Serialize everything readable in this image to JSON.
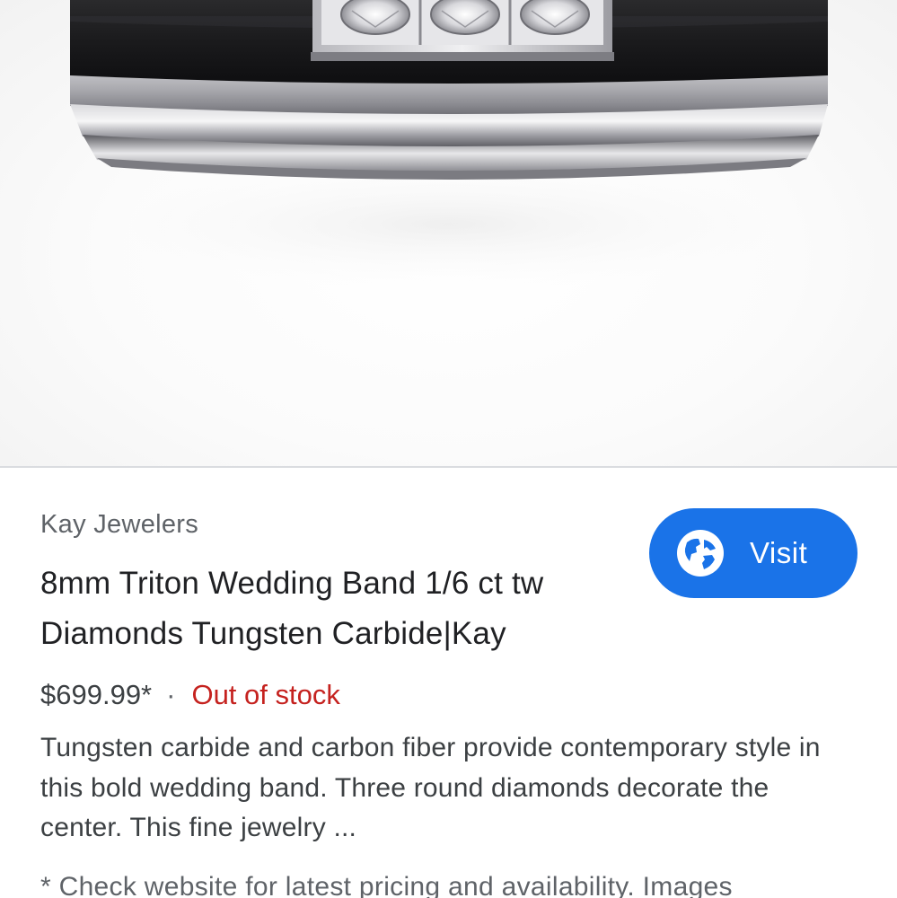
{
  "product": {
    "merchant": "Kay Jewelers",
    "title": "8mm Triton Wedding Band 1/6 ct tw Diamonds Tungsten Carbide|Kay",
    "price": "$699.99*",
    "separator": "·",
    "stock_status": "Out of stock",
    "description": "Tungsten carbide and carbon fiber provide contemporary style in this bold wedding band. Three round diamonds decorate the center. This fine jewelry ...",
    "disclaimer": "* Check website for latest pricing and availability. Images"
  },
  "actions": {
    "visit_label": "Visit",
    "visit_icon": "globe-icon"
  },
  "colors": {
    "accent": "#1a73e8",
    "out_of_stock": "#c5221f",
    "merchant_text": "#5f6368",
    "title_text": "#202124"
  }
}
